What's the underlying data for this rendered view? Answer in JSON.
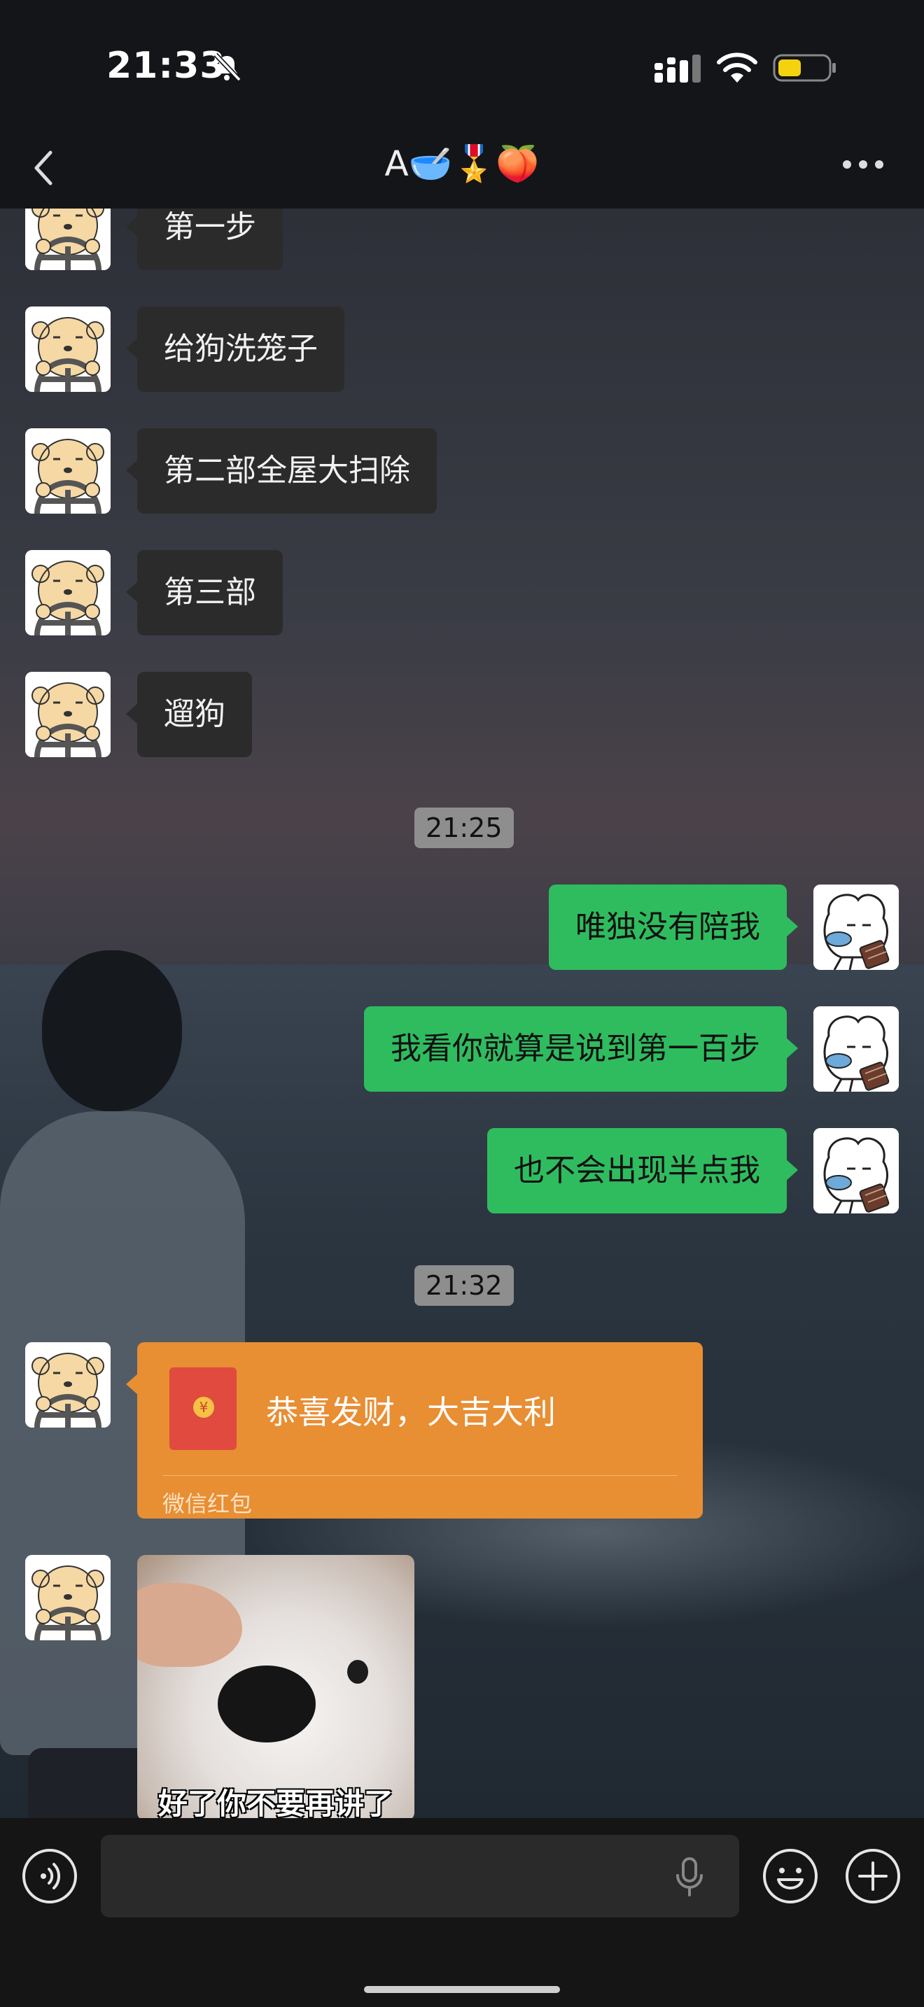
{
  "status": {
    "time": "21:33"
  },
  "chat": {
    "title": "A🥣🎖️🍑"
  },
  "messages": {
    "m1": "第一步",
    "m2": "给狗洗笼子",
    "m3": "第二部全屋大扫除",
    "m4": "第三部",
    "m5": "遛狗",
    "ts1": "21:25",
    "m6": "唯独没有陪我",
    "m7": "我看你就算是说到第一百步",
    "m8": "也不会出现半点我",
    "ts2": "21:32",
    "red_packet": {
      "message": "恭喜发财，大吉大利",
      "label": "微信红包",
      "symbol": "¥"
    },
    "sticker_caption": "好了你不要再讲了"
  },
  "colors": {
    "outgoing_bubble": "#2fbc5f",
    "incoming_bubble": "#2b2b2b",
    "red_packet": "#e88e33"
  },
  "icons": [
    "back-icon",
    "more-icon",
    "bell-slash-icon",
    "signal-icon",
    "wifi-icon",
    "battery-icon",
    "voice-icon",
    "mic-icon",
    "emoji-icon",
    "plus-icon"
  ]
}
